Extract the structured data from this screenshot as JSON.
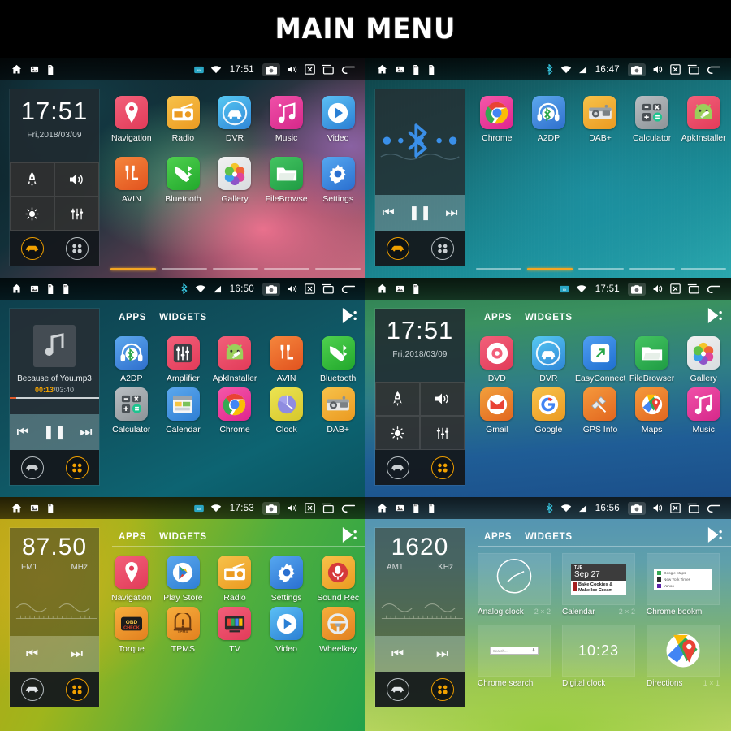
{
  "title": "MAIN MENU",
  "panels": [
    {
      "id": "home-navigation",
      "status": {
        "time": "17:51",
        "icons_left": [
          "home-icon",
          "image-icon",
          "sdcard-icon"
        ],
        "icons_right": [
          "signal-icon",
          "wifi-icon",
          "camera-icon",
          "volume-icon",
          "close-icon",
          "recents-icon",
          "back-icon"
        ]
      },
      "widget": {
        "type": "clock",
        "time": "17:51",
        "date": "Fri,2018/03/09",
        "quick": [
          "rocket-icon",
          "volume-icon",
          "brightness-icon",
          "equalizer-icon"
        ],
        "dock": [
          "car-icon",
          "apps-icon"
        ],
        "dock_active": "car-icon"
      },
      "apps": [
        {
          "label": "Navigation",
          "icon": "navigation-pin"
        },
        {
          "label": "Radio",
          "icon": "radio"
        },
        {
          "label": "DVR",
          "icon": "dvr-car"
        },
        {
          "label": "Music",
          "icon": "music-note"
        },
        {
          "label": "Video",
          "icon": "video-play"
        },
        {
          "label": "AVIN",
          "icon": "avin"
        },
        {
          "label": "Bluetooth",
          "icon": "bt-phone"
        },
        {
          "label": "Gallery",
          "icon": "gallery-flower"
        },
        {
          "label": "FileBrowse",
          "icon": "folder"
        },
        {
          "label": "Settings",
          "icon": "gear"
        }
      ],
      "pages": {
        "count": 5,
        "active": 1
      }
    },
    {
      "id": "home-bluetooth",
      "status": {
        "time": "16:47",
        "icons_left": [
          "home-icon",
          "image-icon",
          "sdcard-icon",
          "sdcard-icon"
        ],
        "icons_right": [
          "bluetooth-icon",
          "wifi-icon",
          "signal-icon",
          "camera-icon",
          "volume-icon",
          "close-icon",
          "recents-icon",
          "back-icon"
        ]
      },
      "widget": {
        "type": "bluetooth",
        "dock": [
          "car-icon",
          "apps-icon"
        ],
        "dock_active": "car-icon"
      },
      "apps": [
        {
          "label": "Chrome",
          "icon": "chrome"
        },
        {
          "label": "A2DP",
          "icon": "a2dp"
        },
        {
          "label": "DAB+",
          "icon": "dab"
        },
        {
          "label": "Calculator",
          "icon": "calculator"
        },
        {
          "label": "ApkInstaller",
          "icon": "apkinstaller"
        }
      ],
      "pages": {
        "count": 5,
        "active": 2
      }
    },
    {
      "id": "apps-music",
      "status": {
        "time": "16:50",
        "icons_left": [
          "home-icon",
          "image-icon",
          "sdcard-icon",
          "sdcard-icon"
        ],
        "icons_right": [
          "bluetooth-icon",
          "wifi-icon",
          "signal-icon",
          "camera-icon",
          "volume-icon",
          "close-icon",
          "recents-icon",
          "back-icon"
        ]
      },
      "widget": {
        "type": "music",
        "track": "Because of You.mp3",
        "elapsed": "00:13",
        "duration": "/03:40",
        "dock": [
          "car-icon",
          "apps-icon"
        ],
        "dock_active": "apps-icon"
      },
      "tabs": {
        "items": [
          "APPS",
          "WIDGETS"
        ],
        "active": "APPS",
        "playstore": "play-store-icon"
      },
      "apps": [
        {
          "label": "A2DP",
          "icon": "a2dp"
        },
        {
          "label": "Amplifier",
          "icon": "amplifier"
        },
        {
          "label": "ApkInstaller",
          "icon": "apkinstaller"
        },
        {
          "label": "AVIN",
          "icon": "avin"
        },
        {
          "label": "Bluetooth",
          "icon": "bt-phone"
        },
        {
          "label": "Calculator",
          "icon": "calculator"
        },
        {
          "label": "Calendar",
          "icon": "calendar"
        },
        {
          "label": "Chrome",
          "icon": "chrome"
        },
        {
          "label": "Clock",
          "icon": "clock"
        },
        {
          "label": "DAB+",
          "icon": "dab"
        }
      ]
    },
    {
      "id": "apps-clock",
      "status": {
        "time": "17:51",
        "icons_left": [
          "home-icon",
          "image-icon",
          "sdcard-icon"
        ],
        "icons_right": [
          "signal-icon",
          "wifi-icon",
          "camera-icon",
          "volume-icon",
          "close-icon",
          "recents-icon",
          "back-icon"
        ]
      },
      "widget": {
        "type": "clock",
        "time": "17:51",
        "date": "Fri,2018/03/09",
        "quick": [
          "rocket-icon",
          "volume-icon",
          "brightness-icon",
          "equalizer-icon"
        ],
        "dock": [
          "car-icon",
          "apps-icon"
        ],
        "dock_active": "apps-icon"
      },
      "tabs": {
        "items": [
          "APPS",
          "WIDGETS"
        ],
        "active": "APPS",
        "playstore": "play-store-icon"
      },
      "apps": [
        {
          "label": "DVD",
          "icon": "dvd"
        },
        {
          "label": "DVR",
          "icon": "dvr-car"
        },
        {
          "label": "EasyConnect",
          "icon": "easyconnect"
        },
        {
          "label": "FileBrowser",
          "icon": "folder"
        },
        {
          "label": "Gallery",
          "icon": "gallery-flower"
        },
        {
          "label": "Gmail",
          "icon": "gmail"
        },
        {
          "label": "Google",
          "icon": "google"
        },
        {
          "label": "GPS Info",
          "icon": "gps-satellite"
        },
        {
          "label": "Maps",
          "icon": "maps"
        },
        {
          "label": "Music",
          "icon": "music-note"
        }
      ]
    },
    {
      "id": "apps-radio-fm",
      "status": {
        "time": "17:53",
        "icons_left": [
          "home-icon",
          "image-icon",
          "sdcard-icon"
        ],
        "icons_right": [
          "signal-icon",
          "wifi-icon",
          "camera-icon",
          "volume-icon",
          "close-icon",
          "recents-icon",
          "back-icon"
        ]
      },
      "widget": {
        "type": "radio",
        "frequency": "87.50",
        "band": "FM1",
        "unit": "MHz",
        "dock": [
          "car-icon",
          "apps-icon"
        ],
        "dock_active": "apps-icon"
      },
      "tabs": {
        "items": [
          "APPS",
          "WIDGETS"
        ],
        "active": "APPS",
        "playstore": "play-store-icon"
      },
      "apps": [
        {
          "label": "Navigation",
          "icon": "navigation-pin"
        },
        {
          "label": "Play Store",
          "icon": "play-store"
        },
        {
          "label": "Radio",
          "icon": "radio"
        },
        {
          "label": "Settings",
          "icon": "gear"
        },
        {
          "label": "Sound Rec",
          "icon": "sound-recorder"
        },
        {
          "label": "Torque",
          "icon": "torque"
        },
        {
          "label": "TPMS",
          "icon": "tpms"
        },
        {
          "label": "TV",
          "icon": "tv"
        },
        {
          "label": "Video",
          "icon": "video-play"
        },
        {
          "label": "Wheelkey",
          "icon": "wheelkey"
        }
      ]
    },
    {
      "id": "widgets-radio-am",
      "status": {
        "time": "16:56",
        "icons_left": [
          "home-icon",
          "image-icon",
          "sdcard-icon",
          "sdcard-icon"
        ],
        "icons_right": [
          "bluetooth-icon",
          "wifi-icon",
          "signal-icon",
          "camera-icon",
          "volume-icon",
          "close-icon",
          "recents-icon",
          "back-icon"
        ]
      },
      "widget": {
        "type": "radio",
        "frequency": "1620",
        "band": "AM1",
        "unit": "KHz",
        "dock": [
          "car-icon",
          "apps-icon"
        ],
        "dock_active": "apps-icon"
      },
      "tabs": {
        "items": [
          "APPS",
          "WIDGETS"
        ],
        "active": "WIDGETS",
        "playstore": "play-store-icon"
      },
      "widgets": [
        {
          "name": "Analog clock",
          "size": "2 × 2",
          "thumb": "analog-clock"
        },
        {
          "name": "Calendar",
          "size": "2 × 2",
          "thumb": "calendar-widget",
          "day": "TUE",
          "date": "Sep 27",
          "event": "Bake Cookies & Make Ice Cream"
        },
        {
          "name": "Chrome bookm",
          "size": "",
          "thumb": "chrome-bookmarks",
          "items": [
            "Google Maps",
            "New York Times",
            "Yahoo"
          ]
        },
        {
          "name": "Chrome search",
          "size": "",
          "thumb": "chrome-search",
          "placeholder": "Search..."
        },
        {
          "name": "Digital clock",
          "size": "",
          "thumb": "digital-clock",
          "time": "10:23"
        },
        {
          "name": "Directions",
          "size": "1 × 1",
          "thumb": "directions"
        }
      ]
    }
  ]
}
